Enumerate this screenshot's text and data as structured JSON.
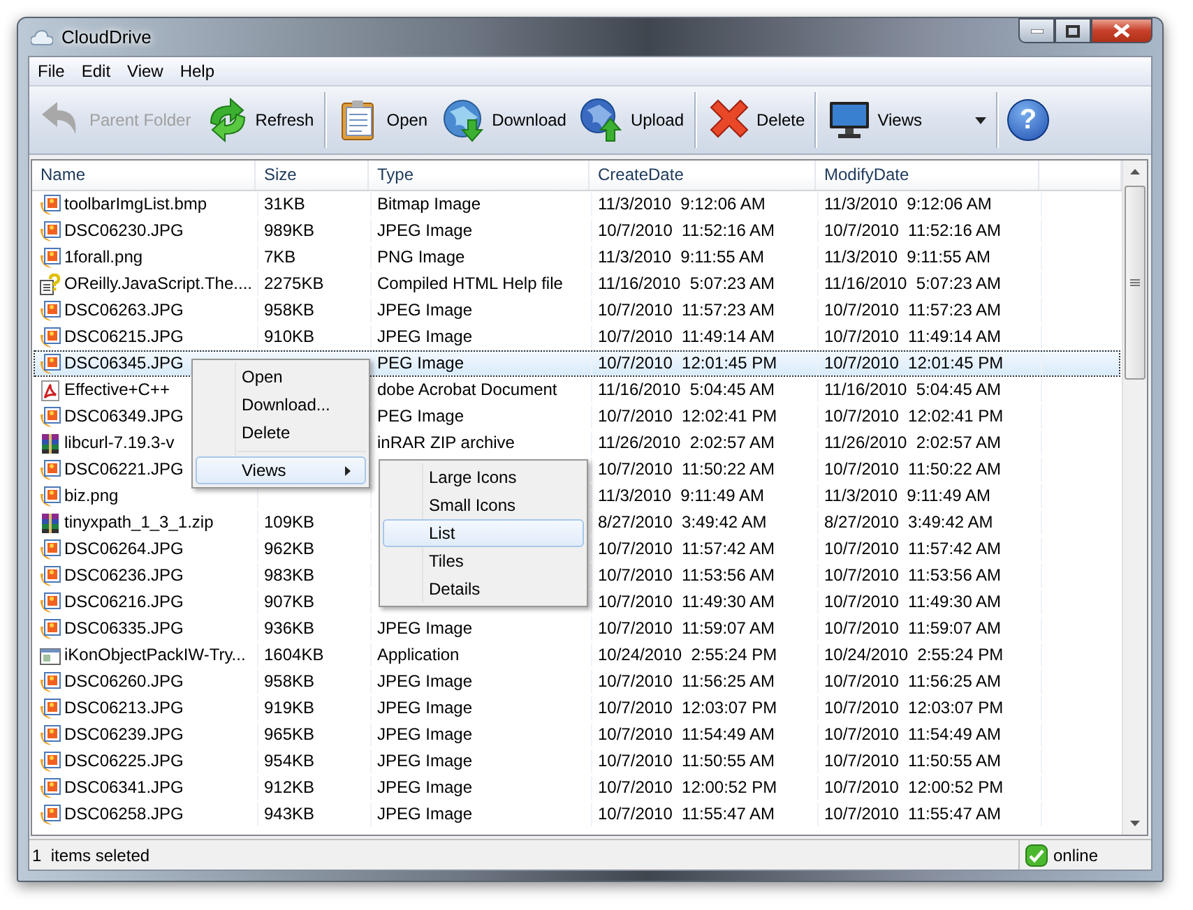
{
  "window": {
    "title": "CloudDrive"
  },
  "menu_bar": [
    "File",
    "Edit",
    "View",
    "Help"
  ],
  "toolbar": {
    "buttons": [
      {
        "label": "Parent Folder",
        "kind": "back",
        "disabled": true
      },
      {
        "label": "Refresh",
        "kind": "refresh",
        "disabled": false
      },
      {
        "label": "Open",
        "kind": "open",
        "disabled": false
      },
      {
        "label": "Download",
        "kind": "download",
        "disabled": false
      },
      {
        "label": "Upload",
        "kind": "upload",
        "disabled": false
      },
      {
        "label": "Delete",
        "kind": "delete",
        "disabled": false
      },
      {
        "label": "Views",
        "kind": "views",
        "disabled": false
      }
    ],
    "help": "?"
  },
  "table": {
    "columns": [
      "Name",
      "Size",
      "Type",
      "CreateDate",
      "ModifyDate"
    ],
    "rows": [
      {
        "kind": "image",
        "name": "toolbarImgList.bmp",
        "size": "31KB",
        "type": "Bitmap Image",
        "created": "11/3/2010  9:12:06 AM",
        "modified": "11/3/2010  9:12:06 AM",
        "selected": false
      },
      {
        "kind": "image",
        "name": "DSC06230.JPG",
        "size": "989KB",
        "type": "JPEG Image",
        "created": "10/7/2010  11:52:16 AM",
        "modified": "10/7/2010  11:52:16 AM",
        "selected": false
      },
      {
        "kind": "image",
        "name": "1forall.png",
        "size": "7KB",
        "type": "PNG Image",
        "created": "11/3/2010  9:11:55 AM",
        "modified": "11/3/2010  9:11:55 AM",
        "selected": false
      },
      {
        "kind": "help",
        "name": "OReilly.JavaScript.The....",
        "size": "2275KB",
        "type": "Compiled HTML Help file",
        "created": "11/16/2010  5:07:23 AM",
        "modified": "11/16/2010  5:07:23 AM",
        "selected": false
      },
      {
        "kind": "image",
        "name": "DSC06263.JPG",
        "size": "958KB",
        "type": "JPEG Image",
        "created": "10/7/2010  11:57:23 AM",
        "modified": "10/7/2010  11:57:23 AM",
        "selected": false
      },
      {
        "kind": "image",
        "name": "DSC06215.JPG",
        "size": "910KB",
        "type": "JPEG Image",
        "created": "10/7/2010  11:49:14 AM",
        "modified": "10/7/2010  11:49:14 AM",
        "selected": false
      },
      {
        "kind": "image",
        "name": "DSC06345.JPG",
        "type": "PEG Image",
        "created": "10/7/2010  12:01:45 PM",
        "modified": "10/7/2010  12:01:45 PM",
        "selected": true
      },
      {
        "kind": "pdf",
        "name": "Effective+C++",
        "type": "dobe Acrobat Document",
        "created": "11/16/2010  5:04:45 AM",
        "modified": "11/16/2010  5:04:45 AM",
        "selected": false
      },
      {
        "kind": "image",
        "name": "DSC06349.JPG",
        "type": "PEG Image",
        "created": "10/7/2010  12:02:41 PM",
        "modified": "10/7/2010  12:02:41 PM",
        "selected": false
      },
      {
        "kind": "archive",
        "name": "libcurl-7.19.3-v",
        "type": "inRAR ZIP archive",
        "created": "11/26/2010  2:02:57 AM",
        "modified": "11/26/2010  2:02:57 AM",
        "selected": false
      },
      {
        "kind": "image",
        "name": "DSC06221.JPG",
        "created": "10/7/2010  11:50:22 AM",
        "modified": "10/7/2010  11:50:22 AM",
        "selected": false
      },
      {
        "kind": "image",
        "name": "biz.png",
        "created": "11/3/2010  9:11:49 AM",
        "modified": "11/3/2010  9:11:49 AM",
        "selected": false
      },
      {
        "kind": "archive",
        "name": "tinyxpath_1_3_1.zip",
        "size": "109KB",
        "created": "8/27/2010  3:49:42 AM",
        "modified": "8/27/2010  3:49:42 AM",
        "selected": false
      },
      {
        "kind": "image",
        "name": "DSC06264.JPG",
        "size": "962KB",
        "created": "10/7/2010  11:57:42 AM",
        "modified": "10/7/2010  11:57:42 AM",
        "selected": false
      },
      {
        "kind": "image",
        "name": "DSC06236.JPG",
        "size": "983KB",
        "created": "10/7/2010  11:53:56 AM",
        "modified": "10/7/2010  11:53:56 AM",
        "selected": false
      },
      {
        "kind": "image",
        "name": "DSC06216.JPG",
        "size": "907KB",
        "created": "10/7/2010  11:49:30 AM",
        "modified": "10/7/2010  11:49:30 AM",
        "selected": false
      },
      {
        "kind": "image",
        "name": "DSC06335.JPG",
        "size": "936KB",
        "type": "JPEG Image",
        "created": "10/7/2010  11:59:07 AM",
        "modified": "10/7/2010  11:59:07 AM",
        "selected": false
      },
      {
        "kind": "app",
        "name": "iKonObjectPackIW-Try...",
        "size": "1604KB",
        "type": "Application",
        "created": "10/24/2010  2:55:24 PM",
        "modified": "10/24/2010  2:55:24 PM",
        "selected": false
      },
      {
        "kind": "image",
        "name": "DSC06260.JPG",
        "size": "958KB",
        "type": "JPEG Image",
        "created": "10/7/2010  11:56:25 AM",
        "modified": "10/7/2010  11:56:25 AM",
        "selected": false
      },
      {
        "kind": "image",
        "name": "DSC06213.JPG",
        "size": "919KB",
        "type": "JPEG Image",
        "created": "10/7/2010  12:03:07 PM",
        "modified": "10/7/2010  12:03:07 PM",
        "selected": false
      },
      {
        "kind": "image",
        "name": "DSC06239.JPG",
        "size": "965KB",
        "type": "JPEG Image",
        "created": "10/7/2010  11:54:49 AM",
        "modified": "10/7/2010  11:54:49 AM",
        "selected": false
      },
      {
        "kind": "image",
        "name": "DSC06225.JPG",
        "size": "954KB",
        "type": "JPEG Image",
        "created": "10/7/2010  11:50:55 AM",
        "modified": "10/7/2010  11:50:55 AM",
        "selected": false
      },
      {
        "kind": "image",
        "name": "DSC06341.JPG",
        "size": "912KB",
        "type": "JPEG Image",
        "created": "10/7/2010  12:00:52 PM",
        "modified": "10/7/2010  12:00:52 PM",
        "selected": false
      },
      {
        "kind": "image",
        "name": "DSC06258.JPG",
        "size": "943KB",
        "type": "JPEG Image",
        "created": "10/7/2010  11:55:47 AM",
        "modified": "10/7/2010  11:55:47 AM",
        "selected": false
      }
    ]
  },
  "context_menu": {
    "items": [
      {
        "kind": "item",
        "label": "Open",
        "submenu": false,
        "selected": false
      },
      {
        "kind": "item",
        "label": "Download...",
        "submenu": false,
        "selected": false
      },
      {
        "kind": "item",
        "label": "Delete",
        "submenu": false,
        "selected": false
      },
      {
        "kind": "separator"
      },
      {
        "kind": "item",
        "label": "Views",
        "submenu": true,
        "selected": true
      }
    ],
    "submenu": [
      {
        "label": "Large Icons",
        "selected": false
      },
      {
        "label": "Small Icons",
        "selected": false
      },
      {
        "label": "List",
        "selected": true
      },
      {
        "label": "Tiles",
        "selected": false
      },
      {
        "label": "Details",
        "selected": false
      }
    ]
  },
  "status_bar": {
    "text": "1  items seleted",
    "connection": "online"
  }
}
